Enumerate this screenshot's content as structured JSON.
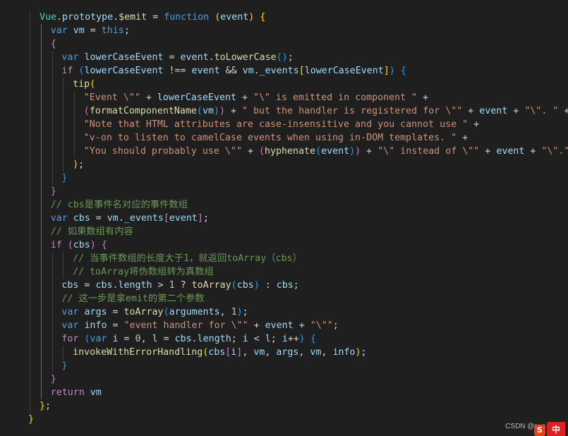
{
  "editor": {
    "language": "javascript",
    "theme": "dark",
    "lines": [
      {
        "indent": 0,
        "tokens": [
          [
            "Vue",
            "cls"
          ],
          [
            ".",
            "op"
          ],
          [
            "prototype",
            "var"
          ],
          [
            ".",
            "op"
          ],
          [
            "$emit",
            "fn"
          ],
          [
            " = ",
            "op"
          ],
          [
            "function",
            "kw"
          ],
          [
            " ",
            "op"
          ],
          [
            "(",
            "pr1"
          ],
          [
            "event",
            "var"
          ],
          [
            ")",
            "pr1"
          ],
          [
            " ",
            "op"
          ],
          [
            "{",
            "pr1"
          ]
        ]
      },
      {
        "indent": 1,
        "tokens": [
          [
            "var",
            "kw"
          ],
          [
            " ",
            "op"
          ],
          [
            "vm",
            "var"
          ],
          [
            " = ",
            "op"
          ],
          [
            "this",
            "kw"
          ],
          [
            ";",
            "op"
          ]
        ]
      },
      {
        "indent": 1,
        "tokens": [
          [
            "{",
            "pr2"
          ]
        ]
      },
      {
        "indent": 2,
        "tokens": [
          [
            "var",
            "kw"
          ],
          [
            " ",
            "op"
          ],
          [
            "lowerCaseEvent",
            "var"
          ],
          [
            " = ",
            "op"
          ],
          [
            "event",
            "var"
          ],
          [
            ".",
            "op"
          ],
          [
            "toLowerCase",
            "fn"
          ],
          [
            "(",
            "pr3"
          ],
          [
            ")",
            "pr3"
          ],
          [
            ";",
            "op"
          ]
        ]
      },
      {
        "indent": 2,
        "tokens": [
          [
            "if",
            "kw2"
          ],
          [
            " ",
            "op"
          ],
          [
            "(",
            "pr3"
          ],
          [
            "lowerCaseEvent",
            "var"
          ],
          [
            " !== ",
            "op"
          ],
          [
            "event",
            "var"
          ],
          [
            " && ",
            "op"
          ],
          [
            "vm",
            "var"
          ],
          [
            ".",
            "op"
          ],
          [
            "_events",
            "var"
          ],
          [
            "[",
            "pr1"
          ],
          [
            "lowerCaseEvent",
            "var"
          ],
          [
            "]",
            "pr1"
          ],
          [
            ")",
            "pr3"
          ],
          [
            " ",
            "op"
          ],
          [
            "{",
            "pr3"
          ]
        ]
      },
      {
        "indent": 3,
        "tokens": [
          [
            "tip",
            "fn"
          ],
          [
            "(",
            "pr1"
          ]
        ]
      },
      {
        "indent": 4,
        "tokens": [
          [
            "\"Event \\\"\"",
            "str"
          ],
          [
            " + ",
            "op"
          ],
          [
            "lowerCaseEvent",
            "var"
          ],
          [
            " + ",
            "op"
          ],
          [
            "\"\\\" is emitted in component \"",
            "str"
          ],
          [
            " +",
            "op"
          ]
        ]
      },
      {
        "indent": 4,
        "tokens": [
          [
            "(",
            "pr2"
          ],
          [
            "formatComponentName",
            "fn"
          ],
          [
            "(",
            "pr3"
          ],
          [
            "vm",
            "var"
          ],
          [
            ")",
            "pr3"
          ],
          [
            ")",
            "pr2"
          ],
          [
            " + ",
            "op"
          ],
          [
            "\" but the handler is registered for \\\"\"",
            "str"
          ],
          [
            " + ",
            "op"
          ],
          [
            "event",
            "var"
          ],
          [
            " + ",
            "op"
          ],
          [
            "\"\\\". \"",
            "str"
          ],
          [
            " +",
            "op"
          ]
        ]
      },
      {
        "indent": 4,
        "tokens": [
          [
            "\"Note that HTML attributes are case-insensitive and you cannot use \"",
            "str"
          ],
          [
            " +",
            "op"
          ]
        ]
      },
      {
        "indent": 4,
        "tokens": [
          [
            "\"v-on to listen to camelCase events when using in-DOM templates. \"",
            "str"
          ],
          [
            " +",
            "op"
          ]
        ]
      },
      {
        "indent": 4,
        "tokens": [
          [
            "\"You should probably use \\\"\"",
            "str"
          ],
          [
            " + ",
            "op"
          ],
          [
            "(",
            "pr2"
          ],
          [
            "hyphenate",
            "fn"
          ],
          [
            "(",
            "pr3"
          ],
          [
            "event",
            "var"
          ],
          [
            ")",
            "pr3"
          ],
          [
            ")",
            "pr2"
          ],
          [
            " + ",
            "op"
          ],
          [
            "\"\\\" instead of \\\"\"",
            "str"
          ],
          [
            " + ",
            "op"
          ],
          [
            "event",
            "var"
          ],
          [
            " + ",
            "op"
          ],
          [
            "\"\\\".\"",
            "str"
          ]
        ]
      },
      {
        "indent": 3,
        "tokens": [
          [
            ")",
            "pr1"
          ],
          [
            ";",
            "op"
          ]
        ]
      },
      {
        "indent": 2,
        "tokens": [
          [
            "}",
            "pr3"
          ]
        ]
      },
      {
        "indent": 1,
        "tokens": [
          [
            "}",
            "pr2"
          ]
        ]
      },
      {
        "indent": 1,
        "tokens": [
          [
            "// cbs是事件名对应的事件数组",
            "cmt"
          ]
        ]
      },
      {
        "indent": 1,
        "tokens": [
          [
            "var",
            "kw"
          ],
          [
            " ",
            "op"
          ],
          [
            "cbs",
            "var"
          ],
          [
            " = ",
            "op"
          ],
          [
            "vm",
            "var"
          ],
          [
            ".",
            "op"
          ],
          [
            "_events",
            "var"
          ],
          [
            "[",
            "pr2"
          ],
          [
            "event",
            "var"
          ],
          [
            "]",
            "pr2"
          ],
          [
            ";",
            "op"
          ]
        ]
      },
      {
        "indent": 1,
        "tokens": [
          [
            "// 如果数组有内容",
            "cmt"
          ]
        ]
      },
      {
        "indent": 1,
        "tokens": [
          [
            "if",
            "kw2"
          ],
          [
            " ",
            "op"
          ],
          [
            "(",
            "pr2"
          ],
          [
            "cbs",
            "var"
          ],
          [
            ")",
            "pr2"
          ],
          [
            " ",
            "op"
          ],
          [
            "{",
            "pr2"
          ]
        ]
      },
      {
        "indent": 3,
        "tokens": [
          [
            "// 当事件数组的长度大于1，就返回toArray（cbs）",
            "cmt"
          ]
        ]
      },
      {
        "indent": 3,
        "tokens": [
          [
            "// toArray将伪数组转为真数组",
            "cmt"
          ]
        ]
      },
      {
        "indent": 2,
        "tokens": [
          [
            "cbs",
            "var"
          ],
          [
            " = ",
            "op"
          ],
          [
            "cbs",
            "var"
          ],
          [
            ".",
            "op"
          ],
          [
            "length",
            "var"
          ],
          [
            " > ",
            "op"
          ],
          [
            "1",
            "num"
          ],
          [
            " ? ",
            "op"
          ],
          [
            "toArray",
            "fn"
          ],
          [
            "(",
            "pr3"
          ],
          [
            "cbs",
            "var"
          ],
          [
            ")",
            "pr3"
          ],
          [
            " : ",
            "op"
          ],
          [
            "cbs",
            "var"
          ],
          [
            ";",
            "op"
          ]
        ]
      },
      {
        "indent": 2,
        "tokens": [
          [
            "// 这一步是拿emit的第二个参数",
            "cmt"
          ]
        ]
      },
      {
        "indent": 2,
        "tokens": [
          [
            "var",
            "kw"
          ],
          [
            " ",
            "op"
          ],
          [
            "args",
            "var"
          ],
          [
            " = ",
            "op"
          ],
          [
            "toArray",
            "fn"
          ],
          [
            "(",
            "pr3"
          ],
          [
            "arguments",
            "var"
          ],
          [
            ", ",
            "op"
          ],
          [
            "1",
            "num"
          ],
          [
            ")",
            "pr3"
          ],
          [
            ";",
            "op"
          ]
        ]
      },
      {
        "indent": 2,
        "tokens": [
          [
            "var",
            "kw"
          ],
          [
            " ",
            "op"
          ],
          [
            "info",
            "var"
          ],
          [
            " = ",
            "op"
          ],
          [
            "\"event handler for \\\"\"",
            "str"
          ],
          [
            " + ",
            "op"
          ],
          [
            "event",
            "var"
          ],
          [
            " + ",
            "op"
          ],
          [
            "\"\\\"\"",
            "str"
          ],
          [
            ";",
            "op"
          ]
        ]
      },
      {
        "indent": 2,
        "tokens": [
          [
            "for",
            "kw2"
          ],
          [
            " ",
            "op"
          ],
          [
            "(",
            "pr3"
          ],
          [
            "var",
            "kw"
          ],
          [
            " ",
            "op"
          ],
          [
            "i",
            "var"
          ],
          [
            " = ",
            "op"
          ],
          [
            "0",
            "num"
          ],
          [
            ", ",
            "op"
          ],
          [
            "l",
            "var"
          ],
          [
            " = ",
            "op"
          ],
          [
            "cbs",
            "var"
          ],
          [
            ".",
            "op"
          ],
          [
            "length",
            "var"
          ],
          [
            "; ",
            "op"
          ],
          [
            "i",
            "var"
          ],
          [
            " < ",
            "op"
          ],
          [
            "l",
            "var"
          ],
          [
            "; ",
            "op"
          ],
          [
            "i",
            "var"
          ],
          [
            "++",
            "op"
          ],
          [
            ")",
            "pr3"
          ],
          [
            " ",
            "op"
          ],
          [
            "{",
            "pr3"
          ]
        ]
      },
      {
        "indent": 3,
        "tokens": [
          [
            "invokeWithErrorHandling",
            "fn"
          ],
          [
            "(",
            "pr1"
          ],
          [
            "cbs",
            "var"
          ],
          [
            "[",
            "pr2"
          ],
          [
            "i",
            "var"
          ],
          [
            "]",
            "pr2"
          ],
          [
            ", ",
            "op"
          ],
          [
            "vm",
            "var"
          ],
          [
            ", ",
            "op"
          ],
          [
            "args",
            "var"
          ],
          [
            ", ",
            "op"
          ],
          [
            "vm",
            "var"
          ],
          [
            ", ",
            "op"
          ],
          [
            "info",
            "var"
          ],
          [
            ")",
            "pr1"
          ],
          [
            ";",
            "op"
          ]
        ]
      },
      {
        "indent": 2,
        "tokens": [
          [
            "}",
            "pr3"
          ]
        ]
      },
      {
        "indent": 1,
        "tokens": [
          [
            "}",
            "pr2"
          ]
        ]
      },
      {
        "indent": 1,
        "tokens": [
          [
            "return",
            "kw2"
          ],
          [
            " ",
            "op"
          ],
          [
            "vm",
            "var"
          ]
        ]
      },
      {
        "indent": 0,
        "tokens": [
          [
            "}",
            "pr1"
          ],
          [
            ";",
            "op"
          ]
        ]
      },
      {
        "indent": -1,
        "tokens": [
          [
            "}",
            "pr1"
          ]
        ]
      }
    ]
  },
  "watermark": "CSDN @rwc",
  "ime_badge": "中",
  "s_icon": "S"
}
